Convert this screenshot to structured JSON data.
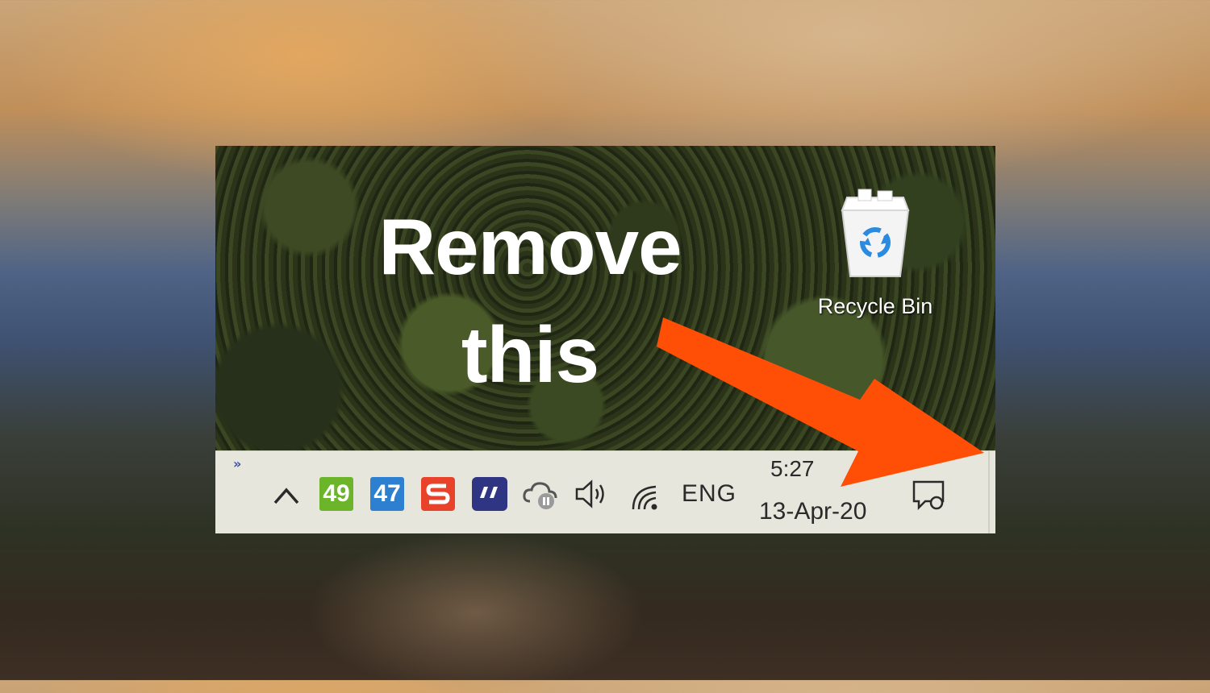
{
  "headline": {
    "line1": "Remove",
    "line2": "this"
  },
  "desktop": {
    "recycle_bin_label": "Recycle Bin"
  },
  "taskbar": {
    "overflow_chevrons": "»",
    "tray_badges": [
      "49",
      "47"
    ],
    "app_s_glyph": "S",
    "app_quote_glyph": "\"",
    "language": "ENG",
    "time": "5:27",
    "date": "13-Apr-20"
  },
  "colors": {
    "arrow": "#ff4f06",
    "taskbar_bg": "#e6e6dc",
    "badge_green": "#6cb52a",
    "badge_blue": "#2d7fd0",
    "app_s": "#e8432a",
    "app_quote": "#2f3583"
  },
  "icons": [
    "chevron-up-icon",
    "cloud-paused-icon",
    "speaker-icon",
    "wifi-icon",
    "notification-center-icon",
    "recycle-bin-icon"
  ]
}
